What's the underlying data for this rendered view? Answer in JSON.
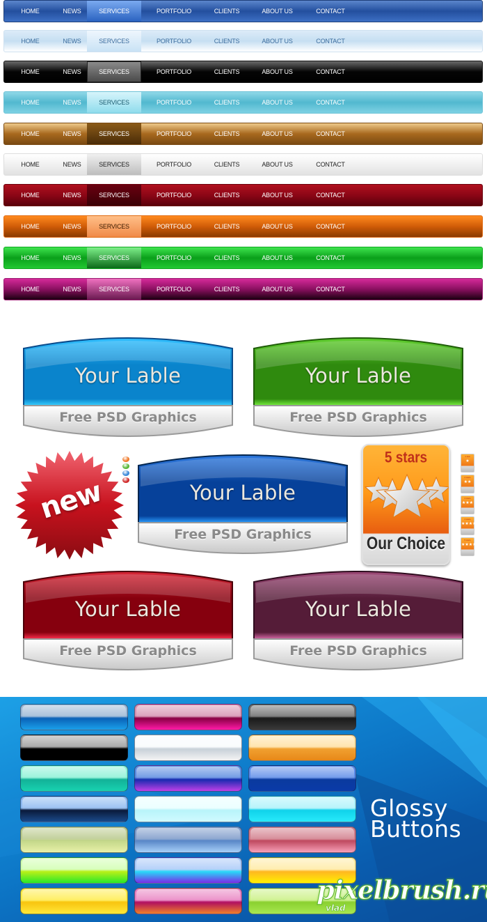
{
  "nav_bars": [
    {
      "theme": "blue",
      "active_index": 2,
      "text_color": "#ffffff",
      "active_text_color": "#ffffff",
      "colors": {
        "top": "#5b86cc",
        "mid": "#234f9e",
        "bottom": "#3d6fc4",
        "active_top": "#7aaaf0",
        "active_bottom": "#2a62c0",
        "border": "#1e3e78"
      }
    },
    {
      "theme": "light-blue",
      "active_index": 2,
      "text_color": "#3d6d9e",
      "active_text_color": "#3d6d9e",
      "colors": {
        "top": "#dcebf8",
        "mid": "#c6dff2",
        "bottom": "#ffffff",
        "active_top": "#eef6fd",
        "active_bottom": "#c9e2f5",
        "border": "#cfe1f0"
      }
    },
    {
      "theme": "black",
      "active_index": 2,
      "text_color": "#ffffff",
      "active_text_color": "#ffffff",
      "colors": {
        "top": "#6a6a6a",
        "mid": "#050505",
        "bottom": "#000000",
        "active_top": "#8a8a8a",
        "active_bottom": "#4a4a4a",
        "border": "#111111"
      }
    },
    {
      "theme": "aqua",
      "active_index": 2,
      "text_color": "#ffffff",
      "active_text_color": "#1d5c70",
      "colors": {
        "top": "#8fd8e8",
        "mid": "#52b8cf",
        "bottom": "#7ed2e4",
        "active_top": "#d6f4fb",
        "active_bottom": "#8fdcec",
        "border": "#6cc2d6"
      }
    },
    {
      "theme": "bronze",
      "active_index": 2,
      "text_color": "#ffffff",
      "active_text_color": "#ffffff",
      "colors": {
        "top": "#eec98a",
        "mid": "#a8691e",
        "bottom": "#7a4a12",
        "active_top": "#8a5a18",
        "active_bottom": "#4a2c08",
        "border": "#7a4a12"
      }
    },
    {
      "theme": "white",
      "active_index": 2,
      "text_color": "#222222",
      "active_text_color": "#222222",
      "colors": {
        "top": "#ffffff",
        "mid": "#f1f1f1",
        "bottom": "#e2e2e2",
        "active_top": "#f0f0f0",
        "active_bottom": "#bdbdbd",
        "border": "#dddddd"
      }
    },
    {
      "theme": "crimson",
      "active_index": 2,
      "text_color": "#ffffff",
      "active_text_color": "#ffffff",
      "colors": {
        "top": "#b0101e",
        "mid": "#8c0616",
        "bottom": "#5a000a",
        "active_top": "#6a0010",
        "active_bottom": "#3a0006",
        "border": "#6a000c"
      }
    },
    {
      "theme": "orange",
      "active_index": 2,
      "text_color": "#ffffff",
      "active_text_color": "#3a1a00",
      "colors": {
        "top": "#ff8a1e",
        "mid": "#d05c08",
        "bottom": "#8a3a00",
        "active_top": "#ffbf88",
        "active_bottom": "#f08a48",
        "border": "#e06a10"
      }
    },
    {
      "theme": "green",
      "active_index": 2,
      "text_color": "#ffffff",
      "active_text_color": "#ffffff",
      "colors": {
        "top": "#3ee44e",
        "mid": "#0aa01a",
        "bottom": "#22c832",
        "active_top": "#7ef08a",
        "active_bottom": "#0a6a18",
        "border": "#10a820"
      }
    },
    {
      "theme": "magenta",
      "active_index": 2,
      "text_color": "#ffffff",
      "active_text_color": "#ffffff",
      "colors": {
        "top": "#d62a9a",
        "mid": "#8a1060",
        "bottom": "#1a0010",
        "active_top": "#f070c0",
        "active_bottom": "#6a1a50",
        "border": "#9a1a70"
      }
    }
  ],
  "nav_labels": [
    "HOME",
    "NEWS",
    "SERVICES",
    "PORTFOLIO",
    "CLIENTS",
    "ABOUT US",
    "CONTACT"
  ],
  "labels": [
    {
      "main": "Your Lable",
      "sub": "Free PSD Graphics",
      "colors": {
        "light": "#32c0ff",
        "dark": "#0a84cc",
        "edge": "#0a4a8a",
        "glow": "#38d0ff"
      }
    },
    {
      "main": "Your Lable",
      "sub": "Free PSD Graphics",
      "colors": {
        "light": "#62d030",
        "dark": "#2f8a0e",
        "edge": "#1e5a08",
        "glow": "#78f040"
      }
    },
    {
      "main": "Your Lable",
      "sub": "Free PSD Graphics",
      "colors": {
        "light": "#2f7ae0",
        "dark": "#06419a",
        "edge": "#04264e",
        "glow": "#2a9cff"
      }
    },
    {
      "main": "Your Lable",
      "sub": "Free PSD Graphics",
      "colors": {
        "light": "#d82838",
        "dark": "#86000e",
        "edge": "#4a0008",
        "glow": "#ff3050"
      }
    },
    {
      "main": "Your Lable",
      "sub": "Free PSD Graphics",
      "colors": {
        "light": "#9e4a78",
        "dark": "#551c38",
        "edge": "#2e0c1e",
        "glow": "#d86aa8"
      }
    }
  ],
  "new_badge": {
    "text": "new",
    "color": "#c8121e",
    "light": "#f06470",
    "dots": [
      "#f07a2a",
      "#58b838",
      "#3a88d8",
      "#d02828"
    ]
  },
  "stars_badge": {
    "title": "5 stars",
    "subtitle": "Our Choice",
    "star_count": 5
  },
  "mini_rating_cards": [
    {
      "title": "1 star",
      "stars": 1
    },
    {
      "title": "2 stars",
      "stars": 2
    },
    {
      "title": "3 stars",
      "stars": 3
    },
    {
      "title": "4 stars",
      "stars": 4
    },
    {
      "title": "5 stars",
      "stars": 5
    }
  ],
  "glossy": {
    "title_line1": "Glossy",
    "title_line2": "Buttons",
    "watermark": "pixelbrush.ru",
    "watermark_sub": "vlad",
    "buttons": [
      [
        "#9ab6d4",
        "#0a62b8",
        "#1aa0ea"
      ],
      [
        "#d690b0",
        "#8a0044",
        "#ff1aa8"
      ],
      [
        "#6a6a6a",
        "#1a1a1a",
        "#3a3a3a"
      ],
      [
        "#9a9a9a",
        "#000000",
        "#000000"
      ],
      [
        "#f8fbfd",
        "#c8d0d8",
        "#f4f4f4"
      ],
      [
        "#ffe0a0",
        "#f0a030",
        "#e88818"
      ],
      [
        "#8af2d6",
        "#12b298",
        "#18d2b0"
      ],
      [
        "#5a8ae0",
        "#1a2ab0",
        "#c040e8"
      ],
      [
        "#5a8ae8",
        "#0a3a9e",
        "#0a3aa8"
      ],
      [
        "#8ab8f0",
        "#0a1a3a",
        "#1a4a8a"
      ],
      [
        "#e8ffff",
        "#b8f4fa",
        "#d0faff"
      ],
      [
        "#aaf2fa",
        "#10d2ea",
        "#28eafa"
      ],
      [
        "#b8c88a",
        "#c4d88a",
        "#e8f0a8"
      ],
      [
        "#7a98c8",
        "#5a88c8",
        "#a8d0f8"
      ],
      [
        "#d07a88",
        "#c04a60",
        "#f8a0b8"
      ],
      [
        "#d0ffb0",
        "#b8f018",
        "#28e828"
      ],
      [
        "#a8c8f8",
        "#28d8f8",
        "#7a2ae8"
      ],
      [
        "#ffeaa0",
        "#ffb820",
        "#fff000"
      ],
      [
        "#ffec48",
        "#f8c410",
        "#ffe838"
      ],
      [
        "#e880c0",
        "#b01060",
        "#f08028"
      ],
      [
        "#c8f080",
        "#8ad030",
        "#a8e850"
      ]
    ]
  }
}
